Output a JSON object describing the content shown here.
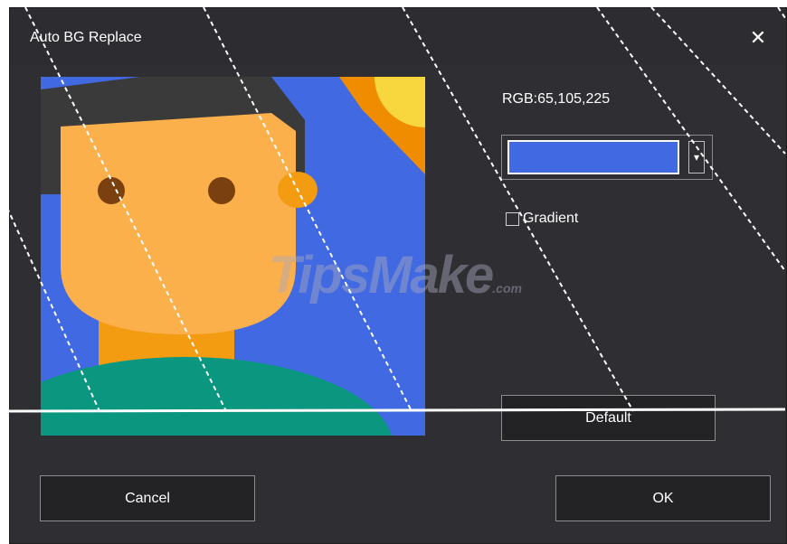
{
  "dialog": {
    "title": "Auto BG Replace",
    "close_glyph": "✕"
  },
  "preview": {
    "background_color": "#4169e1",
    "image_alt": "avatar-portrait"
  },
  "color_picker": {
    "rgb_label": "RGB:65,105,225",
    "selected_color": "#4169e1",
    "dropdown_glyph": "▾"
  },
  "gradient": {
    "label": "Gradient",
    "checked": false
  },
  "buttons": {
    "default_label": "Default",
    "cancel_label": "Cancel",
    "ok_label": "OK"
  },
  "watermark": {
    "text": "TipsMake",
    "suffix": ".com"
  }
}
